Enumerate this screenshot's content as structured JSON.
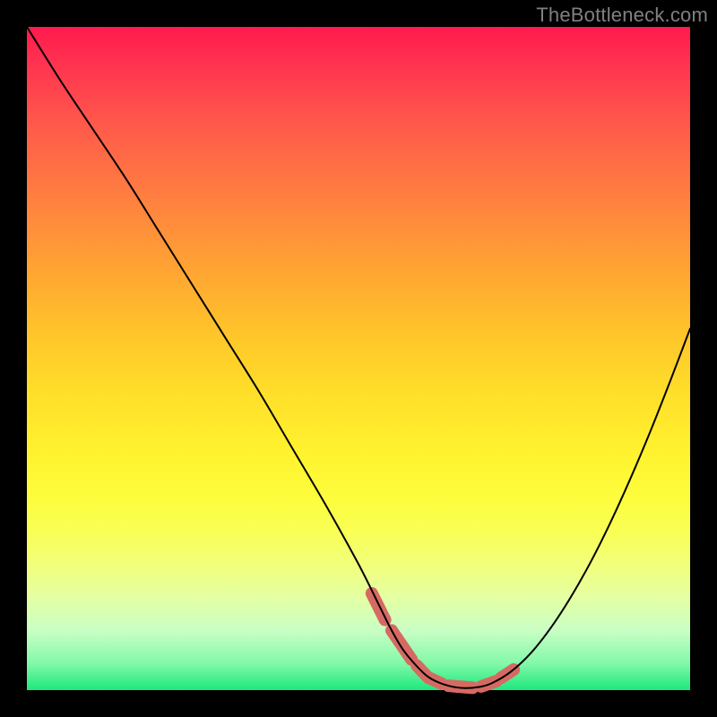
{
  "watermark": "TheBottleneck.com",
  "plot": {
    "inner_width": 740,
    "inner_height": 740
  },
  "chart_data": {
    "type": "line",
    "title": "",
    "xlabel": "",
    "ylabel": "",
    "xlim": [
      0,
      100
    ],
    "ylim": [
      0,
      100
    ],
    "x": [
      0,
      5,
      10,
      15,
      20,
      25,
      30,
      35,
      40,
      45,
      50,
      53,
      55,
      57,
      60,
      62,
      64,
      66,
      68,
      70,
      73,
      76,
      79,
      82,
      85,
      88,
      91,
      94,
      97,
      100
    ],
    "values": [
      100,
      92,
      84.5,
      77,
      69,
      61,
      53,
      45,
      36.5,
      28,
      19,
      13,
      9,
      5.7,
      2.4,
      1.2,
      0.55,
      0.3,
      0.45,
      1.0,
      2.8,
      5.6,
      9.4,
      14.0,
      19.3,
      25.3,
      31.9,
      39.0,
      46.6,
      54.5
    ],
    "marker_segments": [
      {
        "x0": 52.0,
        "y0": 14.6,
        "x1": 54.0,
        "y1": 10.6,
        "color": "#d66a63",
        "width": 14
      },
      {
        "x0": 55.0,
        "y0": 9.0,
        "x1": 58.0,
        "y1": 4.6,
        "color": "#d66a63",
        "width": 14
      },
      {
        "x0": 58.8,
        "y0": 3.7,
        "x1": 60.2,
        "y1": 2.2,
        "color": "#d66a63",
        "width": 14
      },
      {
        "x0": 60.5,
        "y0": 1.9,
        "x1": 62.5,
        "y1": 1.0,
        "color": "#d66a63",
        "width": 14
      },
      {
        "x0": 63.6,
        "y0": 0.65,
        "x1": 67.2,
        "y1": 0.35,
        "color": "#d66a63",
        "width": 14
      },
      {
        "x0": 68.5,
        "y0": 0.55,
        "x1": 70.8,
        "y1": 1.35,
        "color": "#d66a63",
        "width": 14
      },
      {
        "x0": 71.5,
        "y0": 1.85,
        "x1": 73.4,
        "y1": 3.1,
        "color": "#d66a63",
        "width": 14
      }
    ]
  }
}
